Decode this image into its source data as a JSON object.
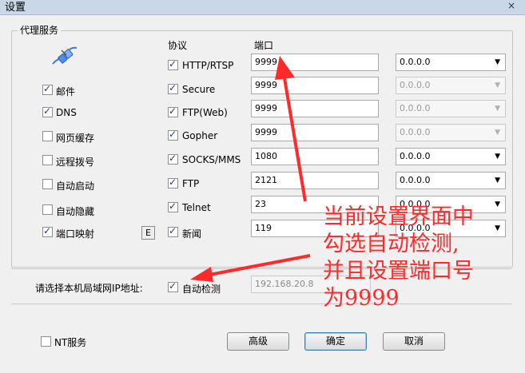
{
  "window": {
    "title": "设置",
    "close_glyph": "×"
  },
  "group": {
    "legend": "代理服务"
  },
  "headers": {
    "protocol": "协议",
    "port": "端口"
  },
  "services": [
    {
      "label": "邮件",
      "checked": true
    },
    {
      "label": "DNS",
      "checked": true
    },
    {
      "label": "网页缓存",
      "checked": false
    },
    {
      "label": "远程拨号",
      "checked": false
    },
    {
      "label": "自动启动",
      "checked": false
    },
    {
      "label": "自动隐藏",
      "checked": false
    },
    {
      "label": "端口映射",
      "checked": true
    }
  ],
  "e_button": "E",
  "protocols": [
    {
      "label": "HTTP/RTSP",
      "checked": true,
      "port": "9999",
      "ip": "0.0.0.0",
      "ip_enabled": true
    },
    {
      "label": "Secure",
      "checked": true,
      "port": "9999",
      "ip": "0.0.0.0",
      "ip_enabled": false
    },
    {
      "label": "FTP(Web)",
      "checked": true,
      "port": "9999",
      "ip": "0.0.0.0",
      "ip_enabled": false
    },
    {
      "label": "Gopher",
      "checked": true,
      "port": "9999",
      "ip": "0.0.0.0",
      "ip_enabled": false
    },
    {
      "label": "SOCKS/MMS",
      "checked": true,
      "port": "1080",
      "ip": "0.0.0.0",
      "ip_enabled": true
    },
    {
      "label": "FTP",
      "checked": true,
      "port": "2121",
      "ip": "0.0.0.0",
      "ip_enabled": true
    },
    {
      "label": "Telnet",
      "checked": true,
      "port": "23",
      "ip": "0.0.0.0",
      "ip_enabled": true
    },
    {
      "label": "新闻",
      "checked": true,
      "port": "119",
      "ip": "0.0.0.0",
      "ip_enabled": true
    }
  ],
  "lan": {
    "label": "请选择本机局域网IP地址:",
    "auto_detect": "自动检测",
    "auto_checked": true,
    "ip_value": "192.168.20.8"
  },
  "nt_service": {
    "label": "NT服务",
    "checked": false
  },
  "buttons": {
    "advanced": "高级",
    "ok": "确定",
    "cancel": "取消"
  },
  "annotation": {
    "line1": "当前设置界面中",
    "line2": "勾选自动检测,",
    "line3": "并且设置端口号",
    "line4": "为9999",
    "color": "#ff2a2a"
  }
}
